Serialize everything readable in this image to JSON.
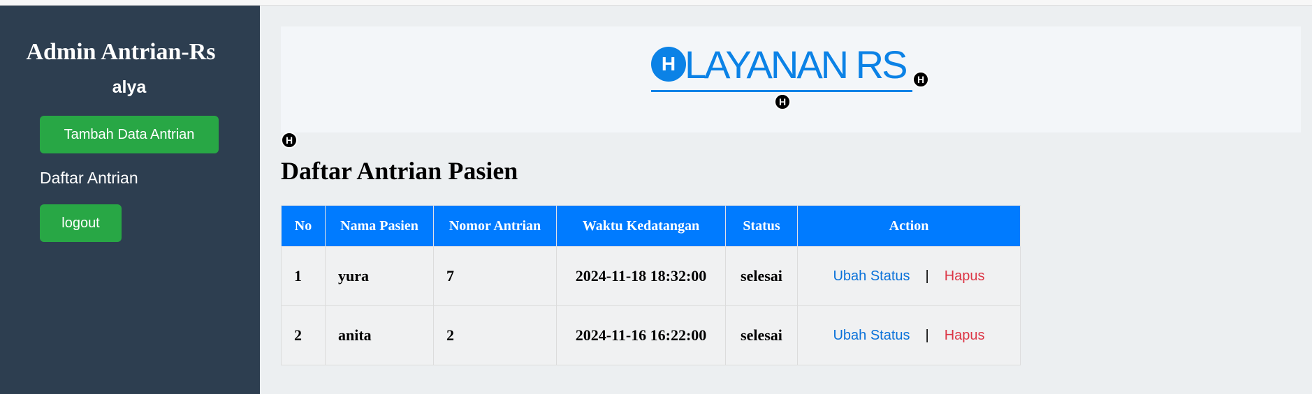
{
  "sidebar": {
    "title": "Admin Antrian-Rs",
    "username": "alya",
    "add_button": "Tambah Data Antrian",
    "nav_link": "Daftar Antrian",
    "logout_button": "logout"
  },
  "banner": {
    "logo_letter": "H",
    "logo_text": "LAYANAN RS",
    "badge_letter": "H"
  },
  "main": {
    "heading": "Daftar Antrian Pasien",
    "table": {
      "headers": [
        "No",
        "Nama Pasien",
        "Nomor Antrian",
        "Waktu Kedatangan",
        "Status",
        "Action"
      ],
      "rows": [
        {
          "no": "1",
          "nama": "yura",
          "nomor": "7",
          "waktu": "2024-11-18 18:32:00",
          "status": "selesai",
          "ubah": "Ubah Status",
          "sep": "|",
          "hapus": "Hapus"
        },
        {
          "no": "2",
          "nama": "anita",
          "nomor": "2",
          "waktu": "2024-11-16 16:22:00",
          "status": "selesai",
          "ubah": "Ubah Status",
          "sep": "|",
          "hapus": "Hapus"
        }
      ]
    }
  },
  "colors": {
    "sidebar_bg": "#2d3e50",
    "accent_green": "#28a745",
    "table_header": "#007bff",
    "logo_blue": "#0b82e6",
    "danger": "#dc3545"
  }
}
